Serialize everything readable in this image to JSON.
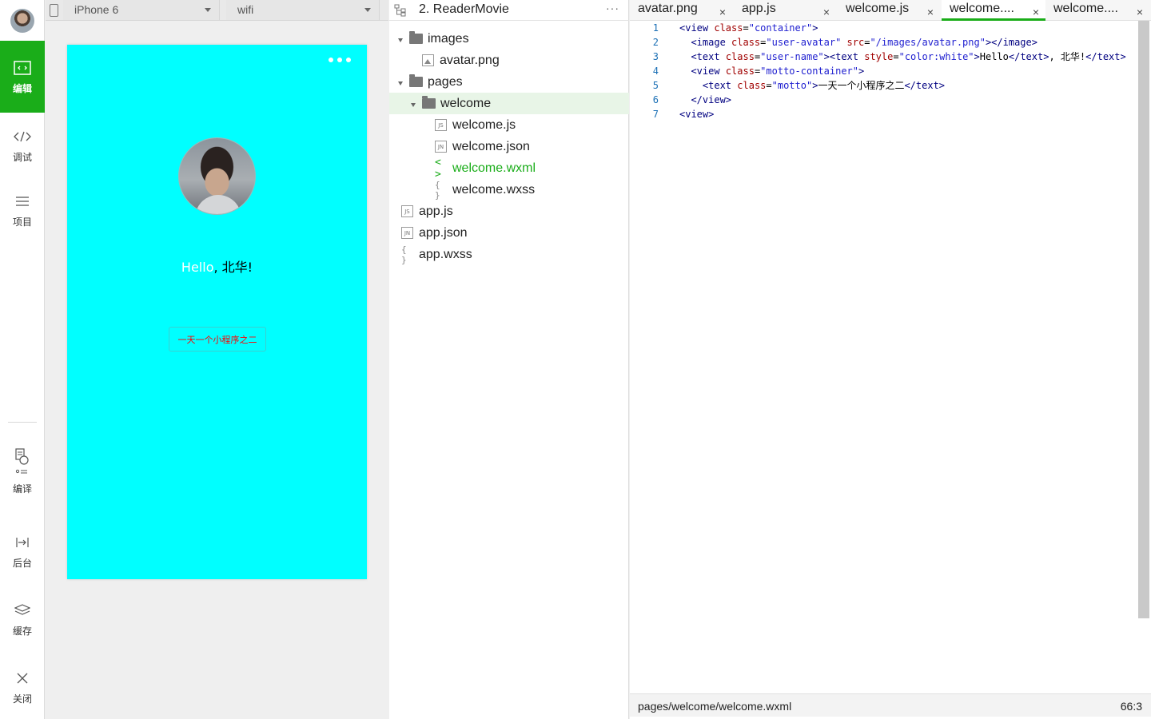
{
  "activity_bar": {
    "items": [
      {
        "label": "编辑",
        "icon": "code-window-icon",
        "active": true
      },
      {
        "label": "调试",
        "icon": "code-brackets-icon"
      },
      {
        "label": "项目",
        "icon": "list-icon"
      },
      {
        "label": "编译",
        "icon": "compile-icon"
      },
      {
        "label": "后台",
        "icon": "background-icon"
      },
      {
        "label": "缓存",
        "icon": "layers-icon"
      },
      {
        "label": "关闭",
        "icon": "close-icon"
      }
    ]
  },
  "simulator": {
    "device": "iPhone 6",
    "network": "wifi",
    "screen_bg": "#00ffff",
    "user_name_hello": "Hello",
    "user_name_rest": ", 北华!",
    "motto": "一天一个小程序之二"
  },
  "file_tree": {
    "project_title": "2. ReaderMovie",
    "more_label": "···",
    "rows": [
      {
        "label": "images",
        "type": "folder"
      },
      {
        "label": "avatar.png",
        "type": "image"
      },
      {
        "label": "pages",
        "type": "folder"
      },
      {
        "label": "welcome",
        "type": "folder"
      },
      {
        "label": "welcome.js",
        "type": "js",
        "badge": "JS"
      },
      {
        "label": "welcome.json",
        "type": "json",
        "badge": "JN"
      },
      {
        "label": "welcome.wxml",
        "type": "wxml",
        "badge": "< >"
      },
      {
        "label": "welcome.wxss",
        "type": "wxss",
        "badge": "{ }"
      },
      {
        "label": "app.js",
        "type": "js",
        "badge": "JS"
      },
      {
        "label": "app.json",
        "type": "json",
        "badge": "JN"
      },
      {
        "label": "app.wxss",
        "type": "wxss",
        "badge": "{ }"
      }
    ]
  },
  "editor": {
    "tabs": [
      {
        "label": "avatar.png"
      },
      {
        "label": "app.js"
      },
      {
        "label": "welcome.js"
      },
      {
        "label": "welcome....",
        "active": true
      },
      {
        "label": "welcome...."
      }
    ],
    "tab_close": "×",
    "line_numbers": [
      "1",
      "2",
      "3",
      "4",
      "5",
      "6",
      "7"
    ],
    "code": {
      "l1": {
        "open": "<view ",
        "attr": "class",
        "eq": "=",
        "val": "\"container\"",
        "close": ">"
      },
      "l2": {
        "indent": "  ",
        "open": "<image ",
        "attr1": "class",
        "eq1": "=",
        "val1": "\"user-avatar\"",
        "attr2": " src",
        "eq2": "=",
        "val2": "\"/images/avatar.png\"",
        "close": "></image>"
      },
      "l3": {
        "indent": "  ",
        "open": "<text ",
        "attr1": "class",
        "eq1": "=",
        "val1": "\"user-name\"",
        "mid": "><text ",
        "attr2": "style",
        "eq2": "=",
        "val2": "\"color:white\"",
        "gt": ">",
        "text1": "Hello",
        "close1": "</text>",
        "text2": ", 北华!",
        "close2": "</text>"
      },
      "l4": {
        "indent": "  ",
        "open": "<view ",
        "attr": "class",
        "eq": "=",
        "val": "\"motto-container\"",
        "close": ">"
      },
      "l5": {
        "indent": "    ",
        "open": "<text ",
        "attr": "class",
        "eq": "=",
        "val": "\"motto\"",
        "gt": ">",
        "text": "一天一个小程序之二",
        "close": "</text>"
      },
      "l6": {
        "indent": "  ",
        "text": "</view>"
      },
      "l7": {
        "text": "<view>"
      }
    },
    "status_path": "pages/welcome/welcome.wxml",
    "status_pos": "66:3"
  },
  "colors": {
    "accent": "#1aad19",
    "motto": "#ff0000",
    "screen": "#00ffff"
  }
}
